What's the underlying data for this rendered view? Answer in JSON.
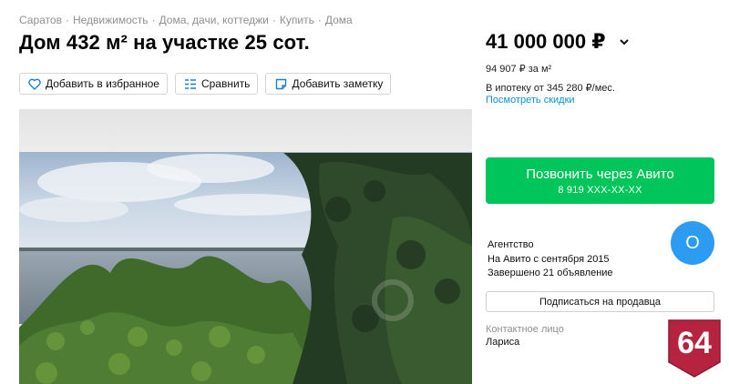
{
  "breadcrumbs": {
    "items": [
      "Саратов",
      "Недвижимость",
      "Дома, дачи, коттеджи",
      "Купить",
      "Дома"
    ],
    "separator": "·"
  },
  "listing": {
    "title": "Дом 432 м² на участке 25 сот."
  },
  "actions": {
    "favorite": "Добавить в избранное",
    "compare": "Сравнить",
    "note": "Добавить заметку"
  },
  "price": {
    "value": "41 000 000 ₽",
    "per_m2": "94 907 ₽ за м²",
    "mortgage": "В ипотеку от 345 280 ₽/мес.",
    "discount_link": "Посмотреть скидки"
  },
  "call_button": {
    "label": "Позвонить через Авито",
    "phone": "8 919 XXX-XX-XX"
  },
  "seller": {
    "type": "Агентство",
    "since": "На Авито с сентября 2015",
    "completed": "Завершено 21 объявление",
    "avatar_letter": "О",
    "subscribe": "Подписаться на продавца"
  },
  "contact": {
    "label": "Контактное лицо",
    "name": "Лариса"
  },
  "watermark_logo": {
    "text": "64"
  },
  "colors": {
    "accent_green": "#00c55a",
    "link_blue": "#0a8fd8",
    "avatar_blue": "#2b9cf2",
    "logo_red": "#b5233f"
  },
  "icons": [
    "heart-icon",
    "compare-icon",
    "note-icon",
    "chevron-down-icon"
  ]
}
